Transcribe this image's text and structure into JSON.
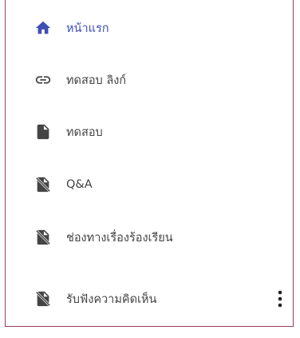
{
  "nav": {
    "items": [
      {
        "label": "หน้าแรก",
        "icon": "home-icon",
        "active": true
      },
      {
        "label": "ทดสอบ ลิงก์",
        "icon": "link-icon",
        "active": false
      },
      {
        "label": "ทดสอบ",
        "icon": "document-icon",
        "active": false
      },
      {
        "label": "Q&A",
        "icon": "document-off-icon",
        "active": false
      },
      {
        "label": "ช่องทางเรื่องร้องเรียน",
        "icon": "document-off-icon",
        "active": false
      },
      {
        "label": "รับฟังความคิดเห็น",
        "icon": "document-off-icon",
        "active": false
      }
    ],
    "more_icon": "more-vertical-icon"
  },
  "colors": {
    "accent": "#3f4fb3",
    "text": "#444444",
    "icon": "#444444",
    "border": "#9b3b5c"
  }
}
